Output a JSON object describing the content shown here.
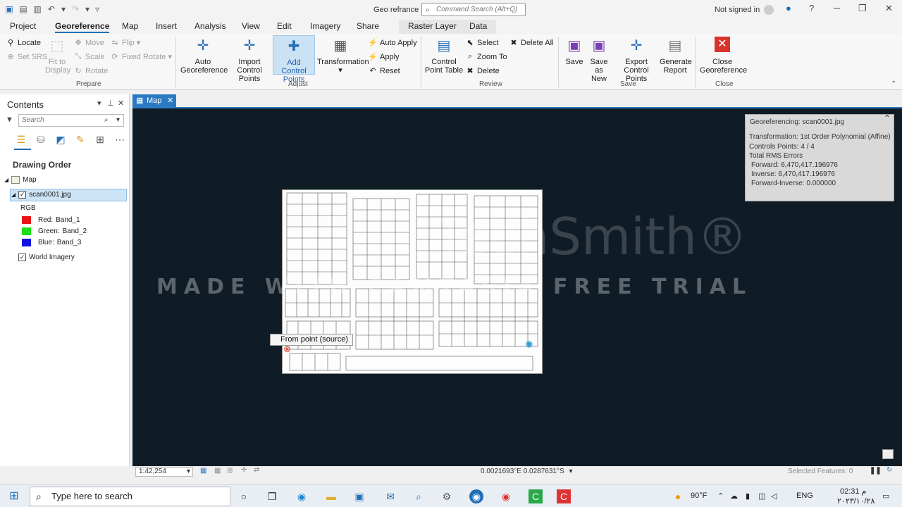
{
  "title_bar": {
    "app_title": "Geo refrance",
    "command_search_placeholder": "Command Search (Alt+Q)",
    "signin": "Not signed in"
  },
  "tabs": [
    "Project",
    "Georeference",
    "Map",
    "Insert",
    "Analysis",
    "View",
    "Edit",
    "Imagery",
    "Share",
    "Raster Layer",
    "Data"
  ],
  "ribbon": {
    "prepare": {
      "label": "Prepare",
      "locate": "Locate",
      "set_srs": "Set SRS",
      "fit_to_display_1": "Fit to",
      "fit_to_display_2": "Display",
      "move": "Move",
      "scale": "Scale",
      "rotate": "Rotate",
      "flip": "Flip",
      "fixed_rotate": "Fixed Rotate"
    },
    "adjust": {
      "label": "Adjust",
      "auto_georeference_1": "Auto",
      "auto_georeference_2": "Georeference",
      "import_cp_1": "Import",
      "import_cp_2": "Control Points",
      "add_cp_1": "Add Control",
      "add_cp_2": "Points",
      "transformation": "Transformation",
      "auto_apply": "Auto Apply",
      "apply": "Apply",
      "reset": "Reset"
    },
    "review": {
      "label": "Review",
      "cp_table_1": "Control",
      "cp_table_2": "Point Table",
      "select": "Select",
      "zoom_to": "Zoom To",
      "delete": "Delete",
      "delete_all": "Delete All"
    },
    "save": {
      "label": "Save",
      "save": "Save",
      "save_as_new_1": "Save",
      "save_as_new_2": "as New",
      "export_cp_1": "Export",
      "export_cp_2": "Control Points",
      "generate_report_1": "Generate",
      "generate_report_2": "Report"
    },
    "close": {
      "label": "Close",
      "close_1": "Close",
      "close_2": "Georeference"
    }
  },
  "contents": {
    "title": "Contents",
    "search_placeholder": "Search",
    "drawing_order": "Drawing Order",
    "map": "Map",
    "layer": "scan0001.jpg",
    "rgb": "RGB",
    "bands": [
      {
        "label": "Red:",
        "band": "Band_1",
        "color": "#e81416"
      },
      {
        "label": "Green:",
        "band": "Band_2",
        "color": "#19e019"
      },
      {
        "label": "Blue:",
        "band": "Band_3",
        "color": "#1414e0"
      }
    ],
    "basemap": "World Imagery"
  },
  "map_tab": "Map",
  "map": {
    "source_tooltip": "From point (source)",
    "watermark_logo": "TechSmith®",
    "watermark_text": "MADE WITH CAMTASIA FREE TRIAL",
    "info": {
      "title": "Georeferencing: scan0001.jpg",
      "transformation": "Transformation: 1st Order Polynomial (Affine)",
      "controls": "Controls Points: 4 / 4",
      "rms": "Total RMS Errors",
      "forward": "Forward: 6,470,417.196976",
      "inverse": "Inverse: 6,470,417.196976",
      "forward_inverse": "Forward-Inverse: 0.000000"
    }
  },
  "status": {
    "scale": "1:42,254",
    "coords": "0.0021693°E 0.0287631°S",
    "selected": "Selected Features: 0"
  },
  "taskbar": {
    "search": "Type here to search",
    "temp": "90°F",
    "lang": "ENG",
    "time": "02:31 م",
    "date": "٢٠٢٣/١٠/٢٨"
  }
}
